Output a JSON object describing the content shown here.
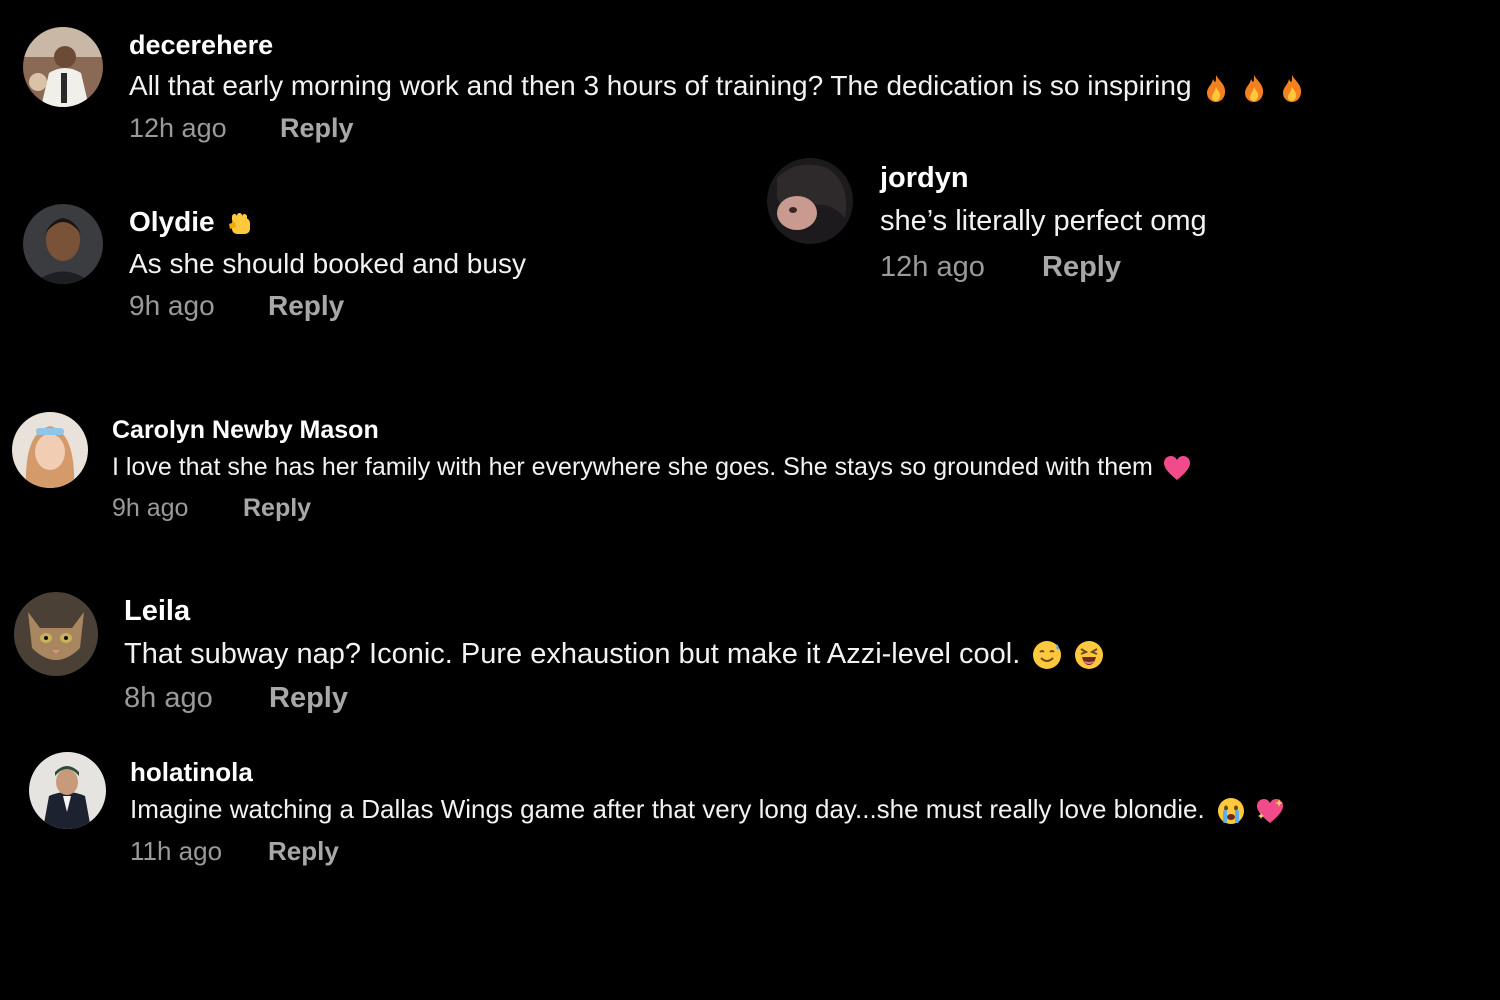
{
  "comments": [
    {
      "username": "decerehere",
      "text": "All that early morning work and then 3 hours of training? The dedication is so inspiring",
      "emojis": [
        "fire",
        "fire",
        "fire"
      ],
      "time": "12h ago",
      "reply_label": "Reply"
    },
    {
      "username": "jordyn",
      "text": "she’s literally perfect omg",
      "emojis": [],
      "time": "12h ago",
      "reply_label": "Reply"
    },
    {
      "username": "Olydie",
      "name_emoji": "fist",
      "text": "As she should booked and busy",
      "emojis": [],
      "time": "9h ago",
      "reply_label": "Reply"
    },
    {
      "username": "Carolyn Newby Mason",
      "text": "I love that she has her family with her everywhere she goes. She stays so grounded with them",
      "emojis": [
        "pink-heart"
      ],
      "time": "9h ago",
      "reply_label": "Reply"
    },
    {
      "username": "Leila",
      "text": "That subway nap? Iconic. Pure exhaustion but make it Azzi-level cool.",
      "emojis": [
        "sweat-smile",
        "laughing"
      ],
      "time": "8h ago",
      "reply_label": "Reply"
    },
    {
      "username": "holatinola",
      "text": "Imagine watching a Dallas Wings game after that very long day...she must really love blondie.",
      "emojis": [
        "crying-face",
        "sparkling-heart"
      ],
      "time": "11h ago",
      "reply_label": "Reply"
    }
  ],
  "colors": {
    "background": "#000000",
    "text": "#ffffff",
    "meta": "#9a9a9a"
  }
}
